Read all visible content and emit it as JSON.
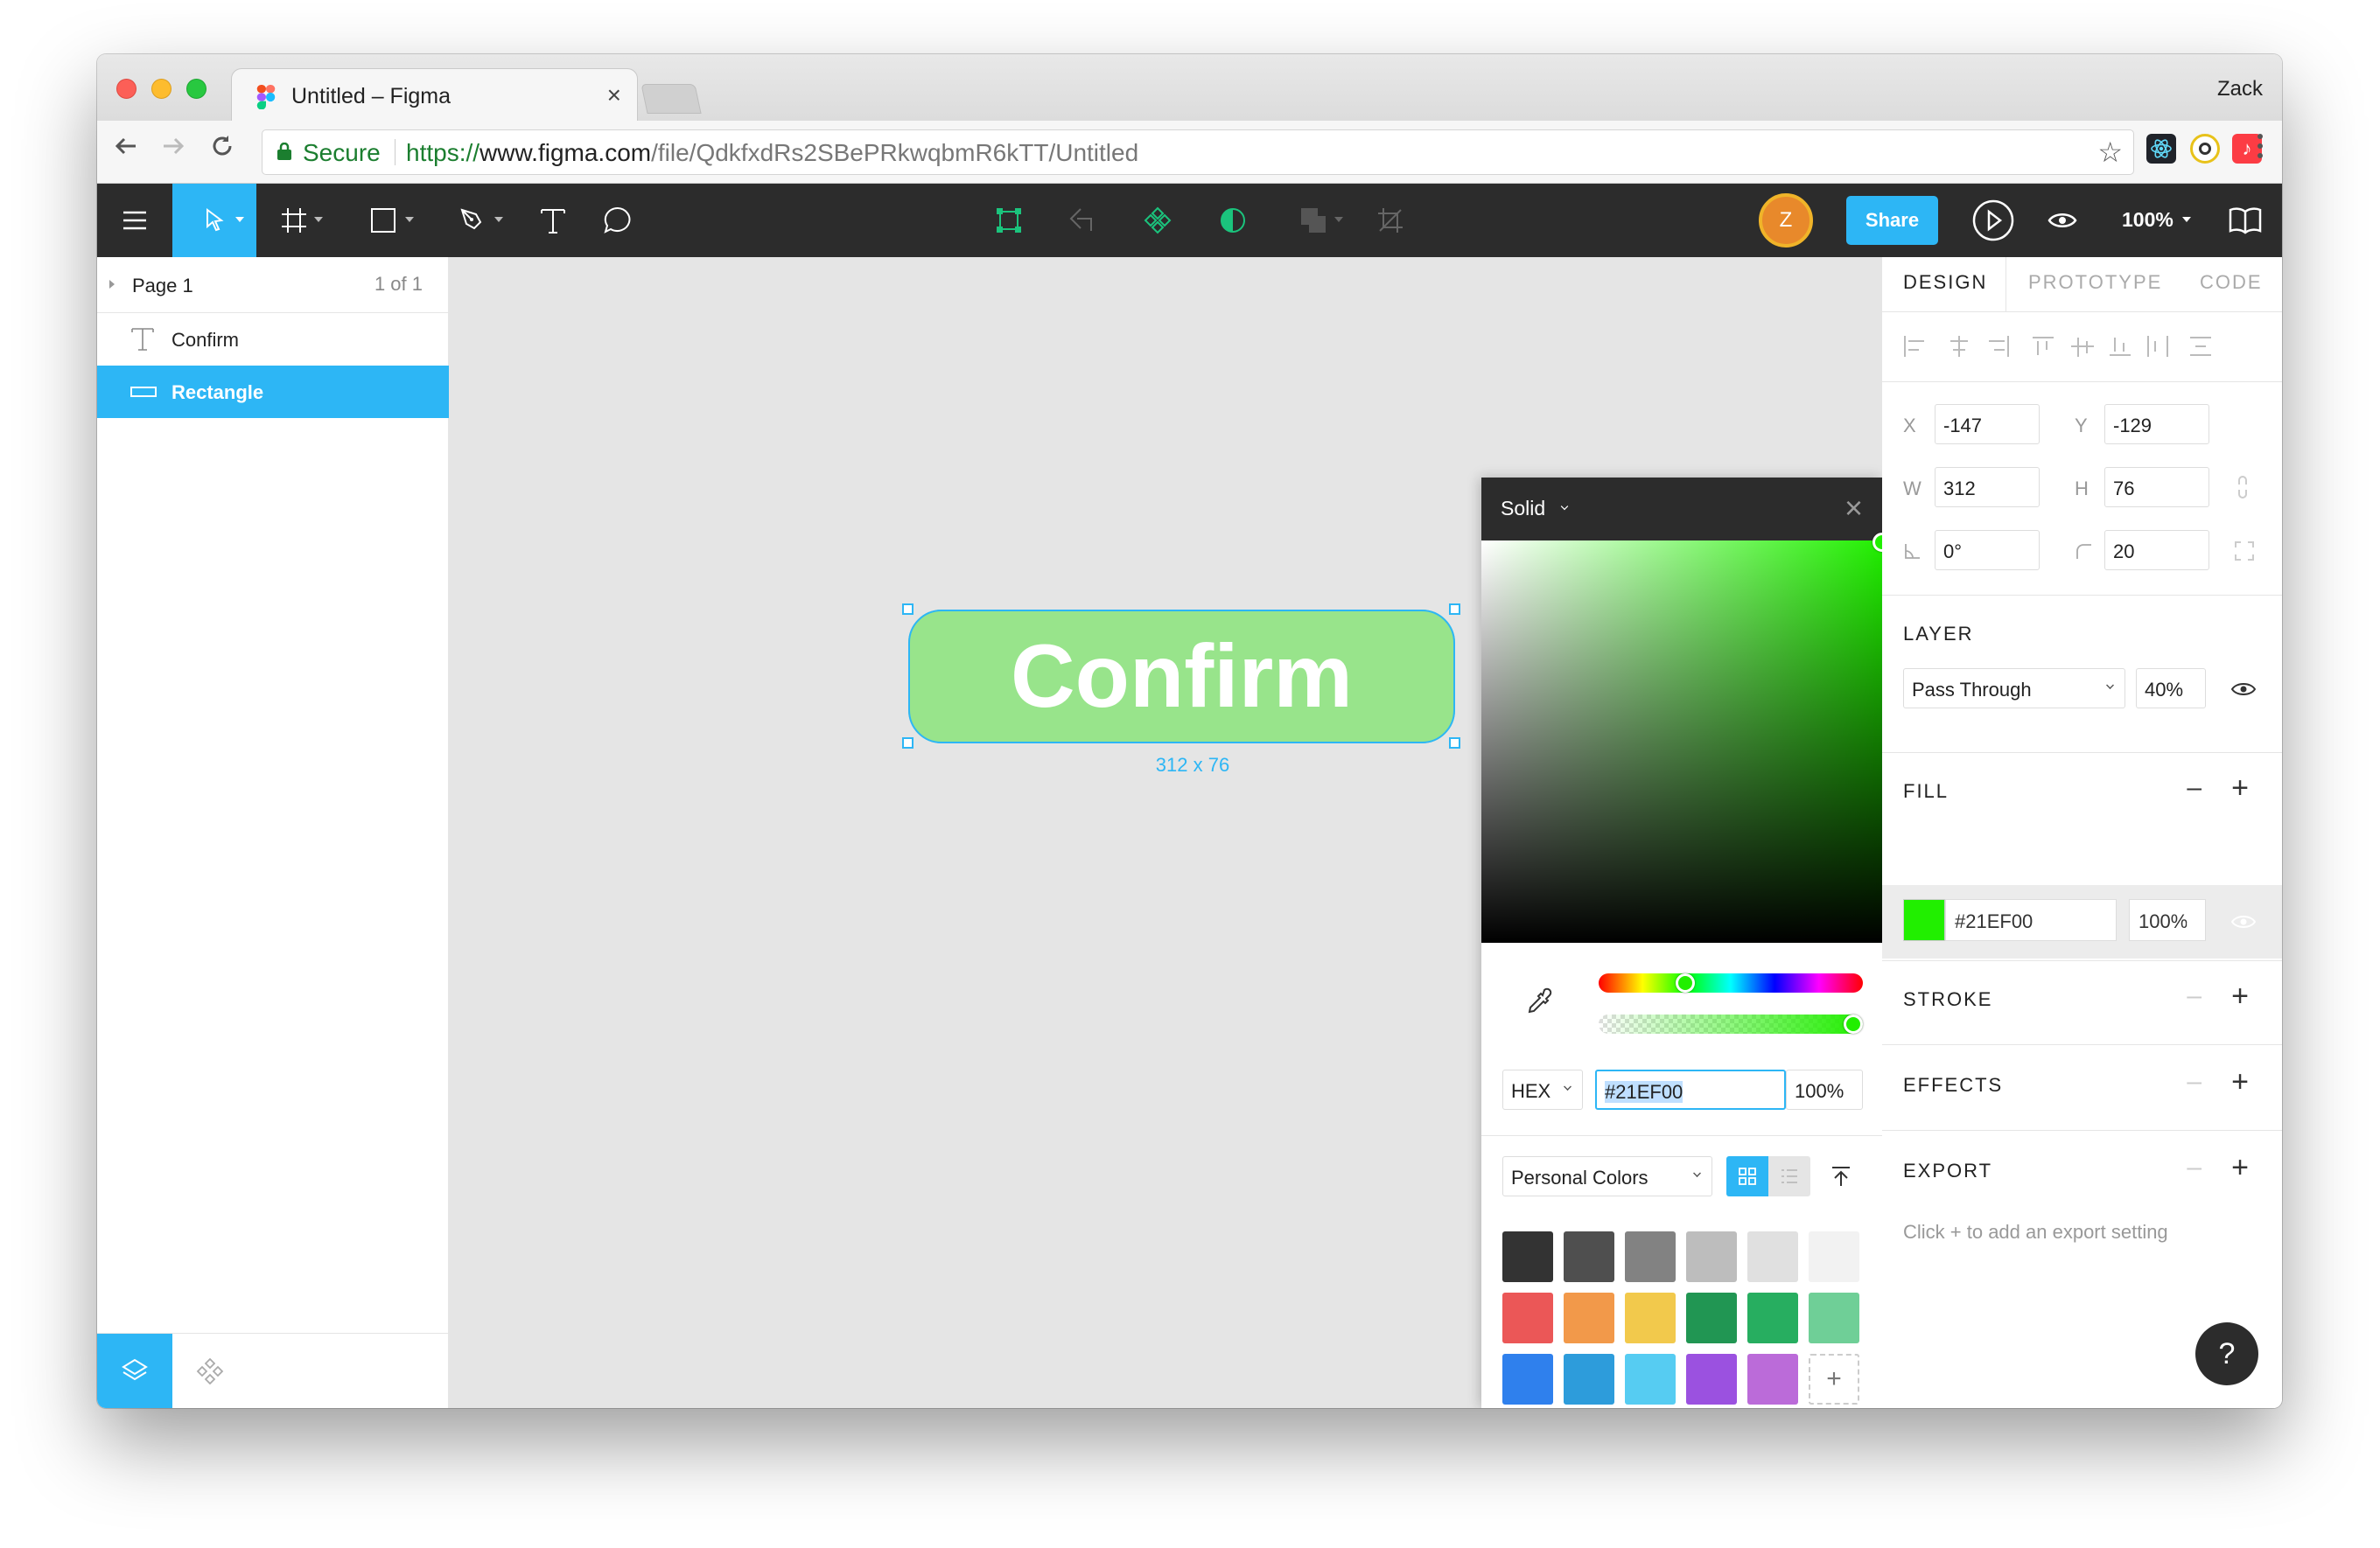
{
  "browser": {
    "tab_title": "Untitled – Figma",
    "profile_name": "Zack",
    "secure_label": "Secure",
    "url_scheme": "https://",
    "url_host": "www.figma.com",
    "url_path": "/file/QdkfxdRs2SBePRkwqbmR6kTT/Untitled",
    "colors": {
      "secure_green": "#1b7e2f"
    }
  },
  "toolbar": {
    "avatar_initial": "Z",
    "share_label": "Share",
    "zoom_label": "100%",
    "tools": [
      "menu-icon",
      "move-icon",
      "frame-icon",
      "rectangle-icon",
      "pen-icon",
      "text-icon",
      "comment-icon"
    ],
    "center_tools": [
      "component-outline-icon",
      "boolean-icon",
      "component-icon",
      "mask-icon",
      "union-icon",
      "crop-icon"
    ],
    "right_tools": [
      "play-icon",
      "eye-icon",
      "library-icon"
    ],
    "colors": {
      "bg": "#2c2c2c",
      "accent": "#2db6f5"
    }
  },
  "layers_panel": {
    "page_name": "Page 1",
    "page_count": "1 of 1",
    "layers": [
      {
        "name": "Confirm",
        "type": "text",
        "selected": false
      },
      {
        "name": "Rectangle",
        "type": "rectangle",
        "selected": true
      }
    ]
  },
  "canvas": {
    "button_text": "Confirm",
    "button_fill": "#98e48b",
    "dimension_label": "312 x 76"
  },
  "color_picker": {
    "mode_label": "Solid",
    "format_label": "HEX",
    "hex_value": "#21EF00",
    "opacity": "100%",
    "library_label": "Personal Colors",
    "swatches": [
      "#333333",
      "#4f4f4f",
      "#828282",
      "#bdbdbd",
      "#e0e0e0",
      "#f2f2f2",
      "#eb5757",
      "#f2994a",
      "#f2c94c",
      "#219653",
      "#27ae60",
      "#6fcf97",
      "#2f80ed",
      "#2d9cdb",
      "#56ccf2",
      "#9b51e0",
      "#bb6bd9"
    ]
  },
  "design_panel": {
    "tabs": [
      "DESIGN",
      "PROTOTYPE",
      "CODE"
    ],
    "x_label": "X",
    "x_value": "-147",
    "y_label": "Y",
    "y_value": "-129",
    "w_label": "W",
    "w_value": "312",
    "h_label": "H",
    "h_value": "76",
    "rotation_value": "0°",
    "radius_value": "20",
    "layer_heading": "LAYER",
    "blend_mode": "Pass Through",
    "layer_opacity": "40%",
    "fill_heading": "FILL",
    "fill_hex": "#21EF00",
    "fill_opacity": "100%",
    "stroke_heading": "STROKE",
    "effects_heading": "EFFECTS",
    "export_heading": "EXPORT",
    "export_hint": "Click + to add an export setting",
    "plus_label": "+",
    "minus_label": "–"
  },
  "help_label": "?"
}
